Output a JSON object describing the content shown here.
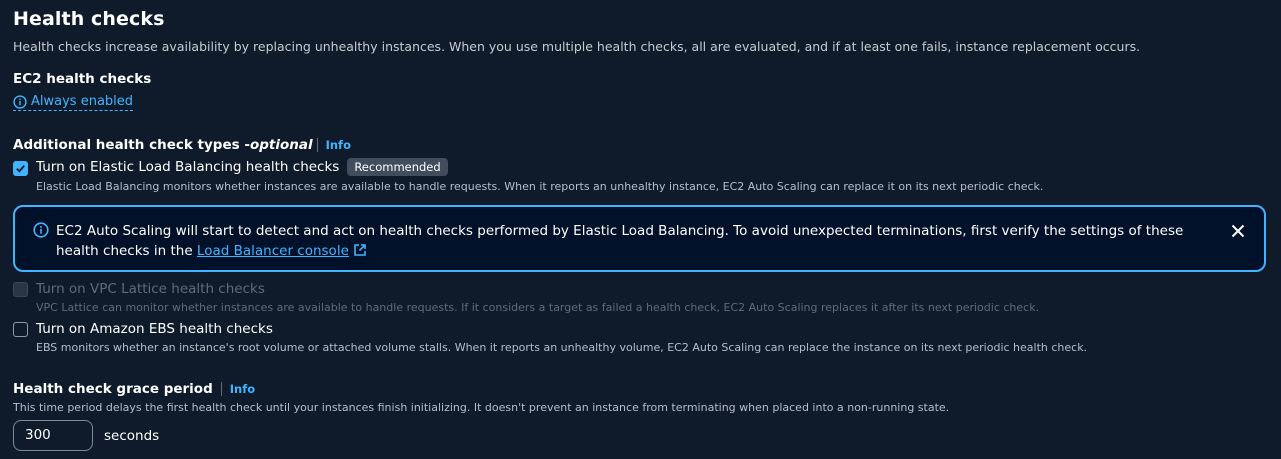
{
  "section": {
    "title": "Health checks",
    "description": "Health checks increase availability by replacing unhealthy instances. When you use multiple health checks, all are evaluated, and if at least one fails, instance replacement occurs."
  },
  "ec2": {
    "label": "EC2 health checks",
    "status": "Always enabled"
  },
  "additional": {
    "label": "Additional health check types - ",
    "optional": "optional",
    "info": "Info",
    "options": [
      {
        "label": "Turn on Elastic Load Balancing health checks",
        "badge": "Recommended",
        "description": "Elastic Load Balancing monitors whether instances are available to handle requests. When it reports an unhealthy instance, EC2 Auto Scaling can replace it on its next periodic check.",
        "checked": true
      },
      {
        "label": "Turn on VPC Lattice health checks",
        "description": "VPC Lattice can monitor whether instances are available to handle requests. If it considers a target as failed a health check, EC2 Auto Scaling replaces it after its next periodic check.",
        "checked": false,
        "disabled": true
      },
      {
        "label": "Turn on Amazon EBS health checks",
        "description": "EBS monitors whether an instance's root volume or attached volume stalls. When it reports an unhealthy volume, EC2 Auto Scaling can replace the instance on its next periodic health check.",
        "checked": false
      }
    ]
  },
  "alert": {
    "text": "EC2 Auto Scaling will start to detect and act on health checks performed by Elastic Load Balancing. To avoid unexpected terminations, first verify the settings of these health checks in the ",
    "link": "Load Balancer console"
  },
  "grace": {
    "label": "Health check grace period",
    "info": "Info",
    "description": "This time period delays the first health check until your instances finish initializing. It doesn't prevent an instance from terminating when placed into a non-running state.",
    "value": "300",
    "unit": "seconds"
  },
  "colors": {
    "background": "#0f1b2a",
    "accent": "#42b4ff",
    "alert_background": "#001129"
  }
}
